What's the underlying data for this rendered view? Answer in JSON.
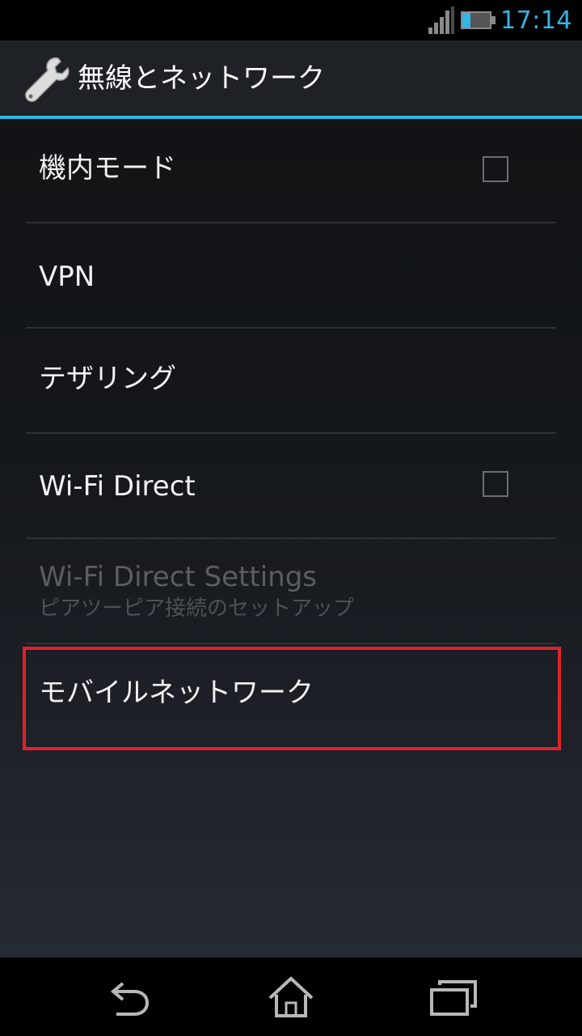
{
  "status_bar": {
    "time": "17:14",
    "signal_icon": "signal-icon",
    "battery_icon": "battery-icon",
    "accent_color": "#33b5e5"
  },
  "action_bar": {
    "icon": "wrench-icon",
    "title": "無線とネットワーク"
  },
  "settings": {
    "airplane_mode": {
      "title": "機内モード",
      "checked": false
    },
    "vpn": {
      "title": "VPN"
    },
    "tethering": {
      "title": "テザリング"
    },
    "wifi_direct": {
      "title": "Wi-Fi Direct",
      "checked": false
    },
    "wifi_direct_settings": {
      "title": "Wi-Fi Direct Settings",
      "summary": "ピアツーピア接続のセットアップ",
      "enabled": false
    },
    "mobile_network": {
      "title": "モバイルネットワーク",
      "highlight_color": "#e0212b"
    }
  },
  "nav_bar": {
    "back_icon": "back-icon",
    "home_icon": "home-icon",
    "recents_icon": "recent-apps-icon"
  }
}
